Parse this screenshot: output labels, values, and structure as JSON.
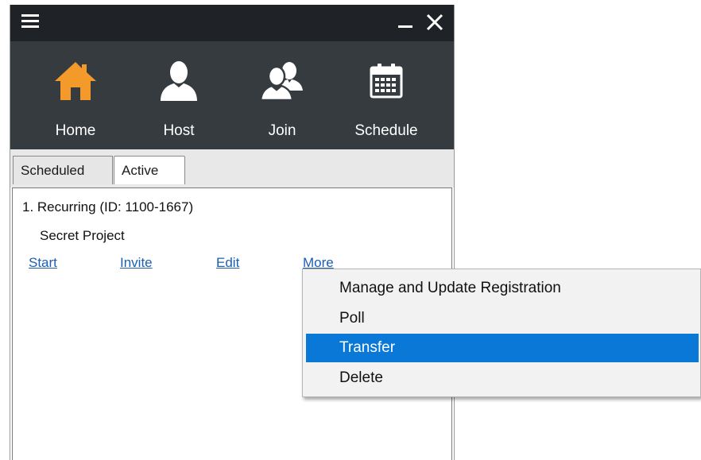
{
  "toolbar": {
    "items": [
      {
        "label": "Home",
        "icon": "home-icon",
        "color": "#f39a2a"
      },
      {
        "label": "Host",
        "icon": "person-icon",
        "color": "#ffffff"
      },
      {
        "label": "Join",
        "icon": "people-icon",
        "color": "#ffffff"
      },
      {
        "label": "Schedule",
        "icon": "calendar-icon",
        "color": "#ffffff"
      }
    ]
  },
  "tabs": [
    {
      "label": "Scheduled",
      "selected": true
    },
    {
      "label": "Active",
      "selected": false
    }
  ],
  "meeting": {
    "title": "1. Recurring  (ID: 1100-1667)",
    "name": "Secret Project",
    "actions": {
      "start": "Start",
      "invite": "Invite",
      "edit": "Edit",
      "more": "More"
    }
  },
  "context_menu": {
    "items": [
      {
        "label": "Manage and Update Registration",
        "highlighted": false
      },
      {
        "label": "Poll",
        "highlighted": false
      },
      {
        "label": "Transfer",
        "highlighted": true
      },
      {
        "label": "Delete",
        "highlighted": false
      }
    ]
  },
  "colors": {
    "titlebar": "#1f2328",
    "toolbar": "#363b40",
    "accent": "#f39a2a",
    "link": "#1c5fb0",
    "highlight": "#0a78d7"
  }
}
